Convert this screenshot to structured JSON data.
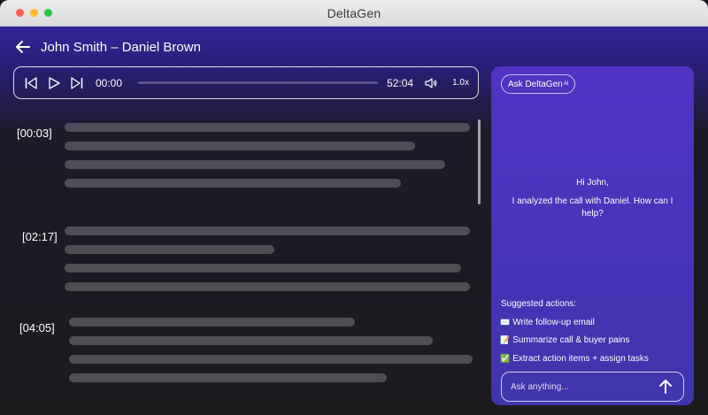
{
  "window": {
    "title": "DeltaGen"
  },
  "header": {
    "title": "John Smith – Daniel Brown"
  },
  "player": {
    "current_time": "00:00",
    "duration": "52:04",
    "speed": "1.0x",
    "progress": 0
  },
  "transcript": {
    "timestamps": [
      "[00:03]",
      "[02:17]",
      "[04:05]"
    ]
  },
  "assistant": {
    "chip_label": "Ask DeltaGen",
    "chip_sup": "AI",
    "greeting_line1": "Hi John,",
    "greeting_line2": "I analyzed the call with Daniel. How can I help?",
    "suggestions_title": "Suggested actions:",
    "suggestions": [
      {
        "icon": "✉️",
        "label": "Write follow-up email"
      },
      {
        "icon": "📝",
        "label": "Summarize call & buyer pains"
      },
      {
        "icon": "✅",
        "label": "Extract action items + assign tasks"
      }
    ],
    "input_placeholder": "Ask anything..."
  }
}
